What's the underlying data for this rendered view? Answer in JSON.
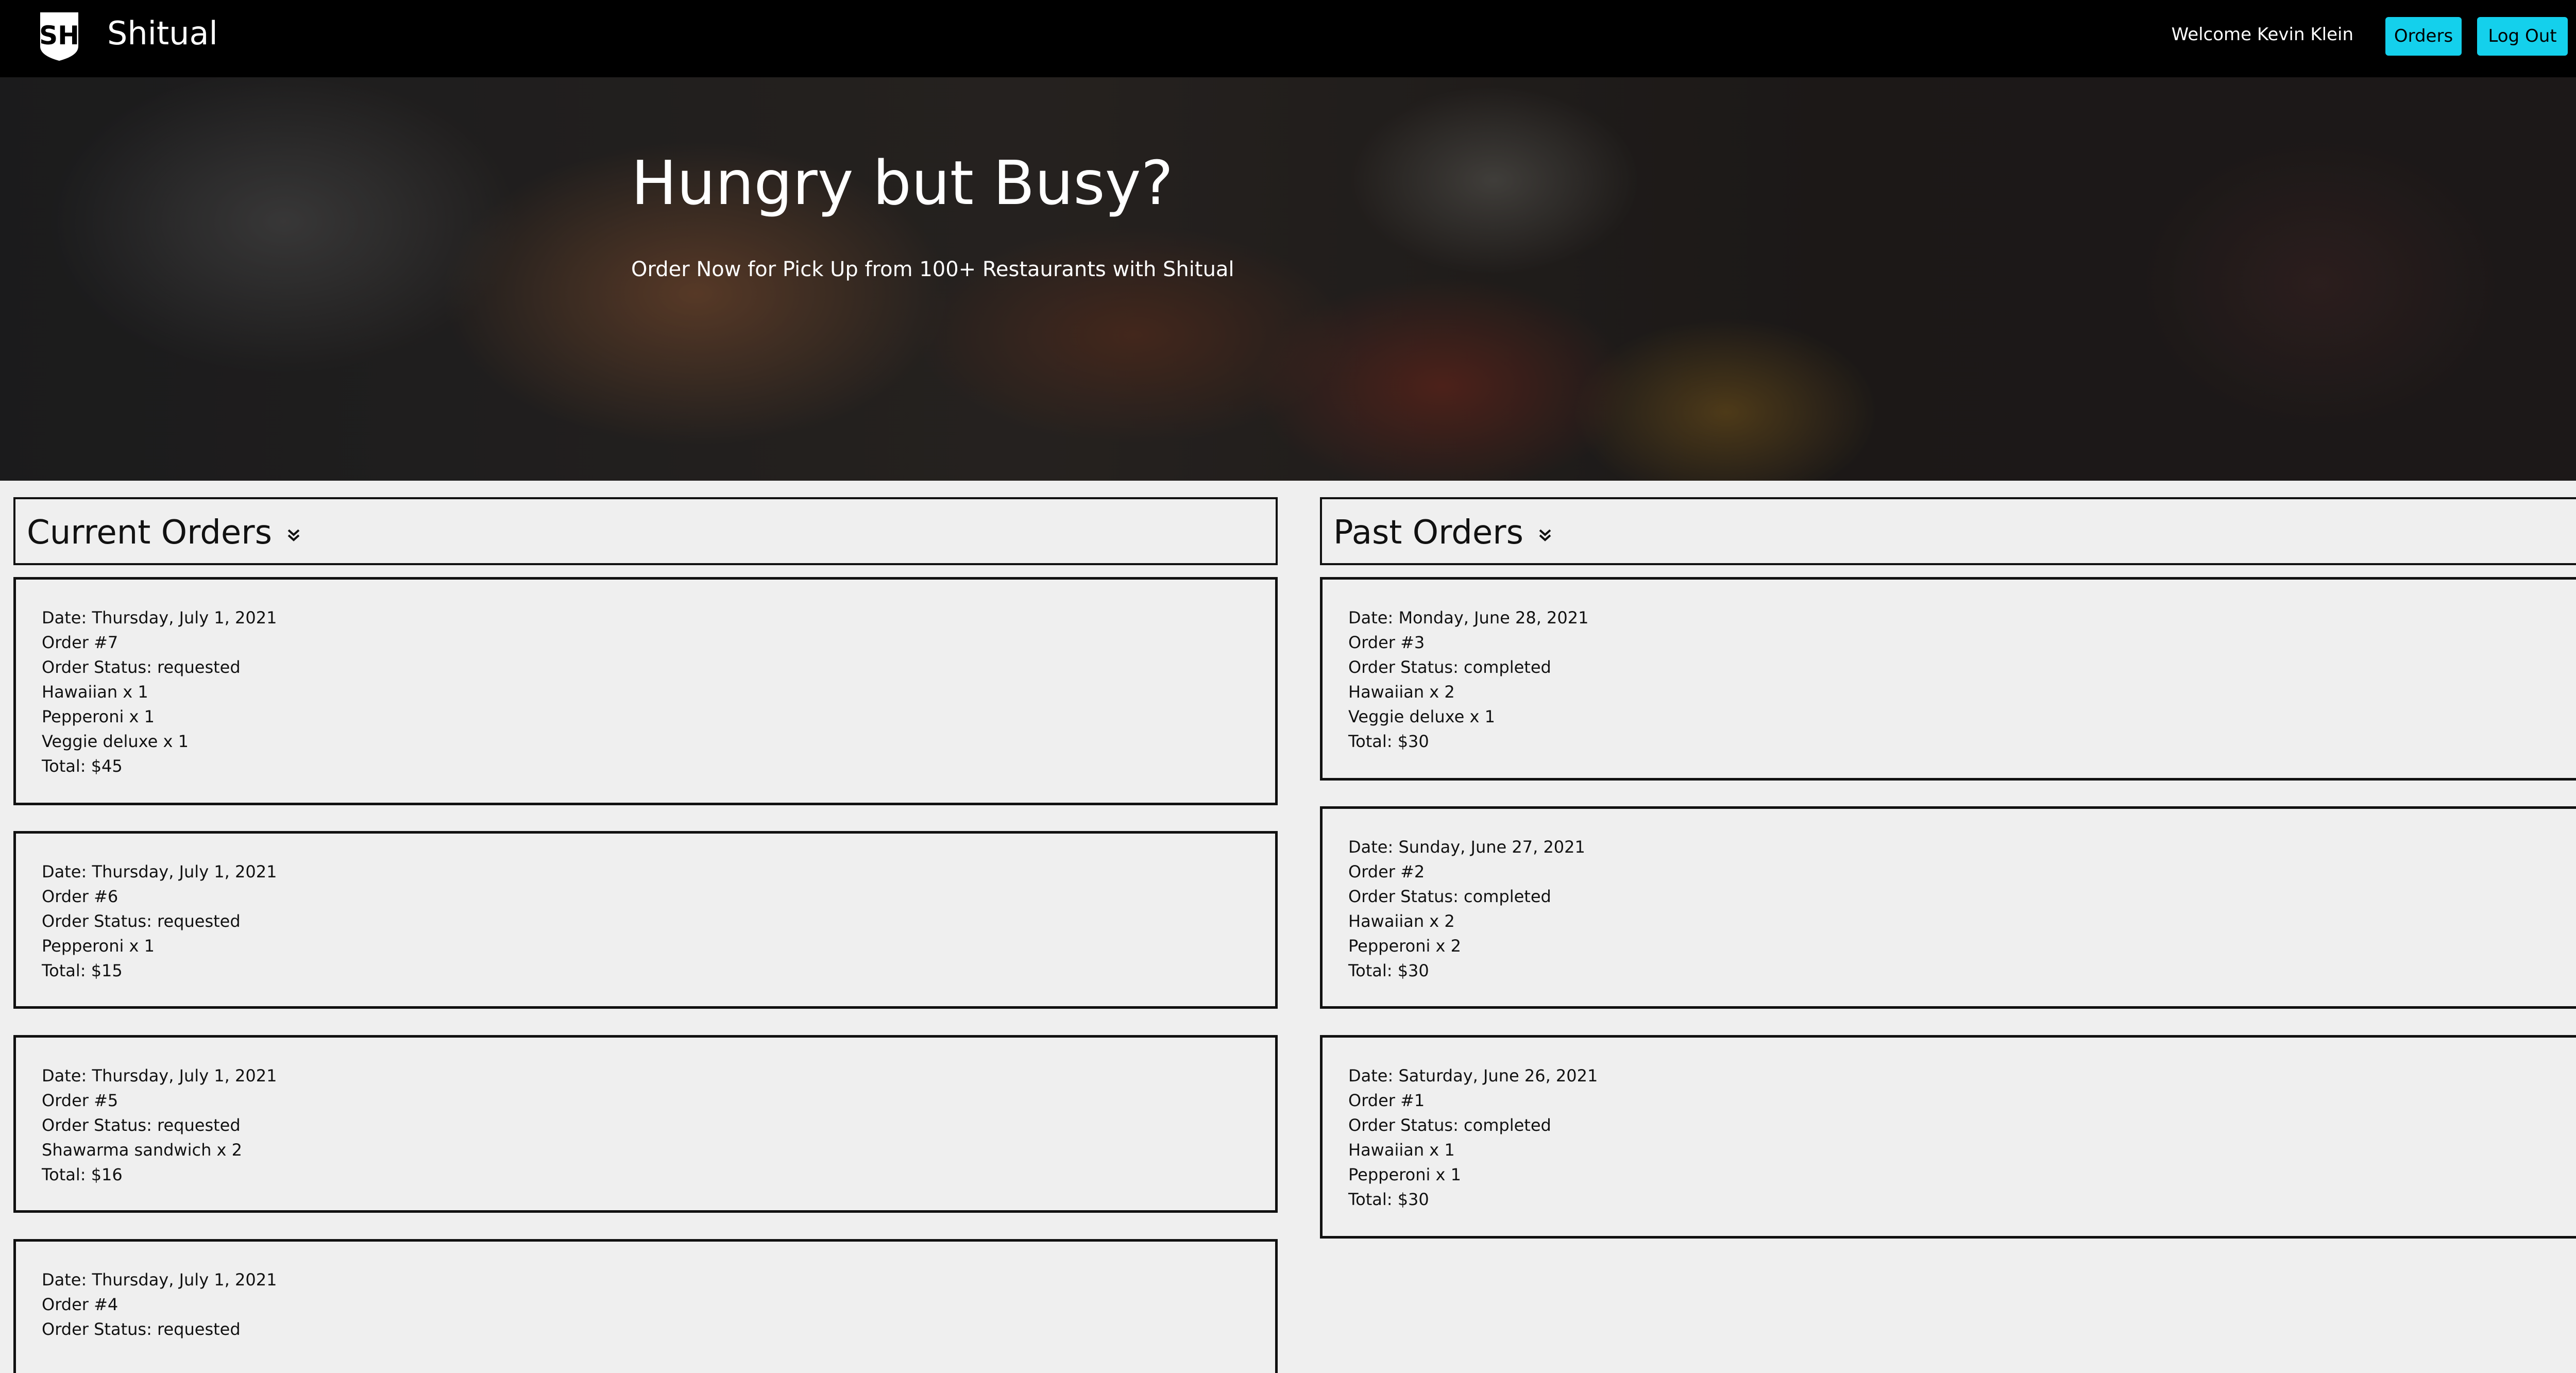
{
  "navbar": {
    "brand": "Shitual",
    "logo_text": "SH",
    "welcome": "Welcome Kevin Klein",
    "orders_label": "Orders",
    "logout_label": "Log Out",
    "button_color": "#14d0ec"
  },
  "hero": {
    "title": "Hungry but Busy?",
    "subtitle": "Order Now for Pick Up from 100+ Restaurants with Shitual"
  },
  "current_orders": {
    "title": "Current Orders",
    "icon": "double-chevron-down-icon",
    "orders": [
      {
        "date": "Date: Thursday, July 1, 2021",
        "number": "Order #7",
        "status": "Order Status: requested",
        "items": [
          "Hawaiian x 1",
          "Pepperoni x 1",
          "Veggie deluxe x 1"
        ],
        "total": "Total: $45"
      },
      {
        "date": "Date: Thursday, July 1, 2021",
        "number": "Order #6",
        "status": "Order Status: requested",
        "items": [
          "Pepperoni x 1"
        ],
        "total": "Total: $15"
      },
      {
        "date": "Date: Thursday, July 1, 2021",
        "number": "Order #5",
        "status": "Order Status: requested",
        "items": [
          "Shawarma sandwich x 2"
        ],
        "total": "Total: $16"
      },
      {
        "date": "Date: Thursday, July 1, 2021",
        "number": "Order #4",
        "status": "Order Status: requested",
        "items": [],
        "total": ""
      }
    ]
  },
  "past_orders": {
    "title": "Past Orders",
    "icon": "double-chevron-down-icon",
    "orders": [
      {
        "date": "Date: Monday, June 28, 2021",
        "number": "Order #3",
        "status": "Order Status: completed",
        "items": [
          "Hawaiian x 2",
          "Veggie deluxe x 1"
        ],
        "total": "Total: $30"
      },
      {
        "date": "Date: Sunday, June 27, 2021",
        "number": "Order #2",
        "status": "Order Status: completed",
        "items": [
          "Hawaiian x 2",
          "Pepperoni x 2"
        ],
        "total": "Total: $30"
      },
      {
        "date": "Date: Saturday, June 26, 2021",
        "number": "Order #1",
        "status": "Order Status: completed",
        "items": [
          "Hawaiian x 1",
          "Pepperoni x 1"
        ],
        "total": "Total: $30"
      }
    ]
  }
}
